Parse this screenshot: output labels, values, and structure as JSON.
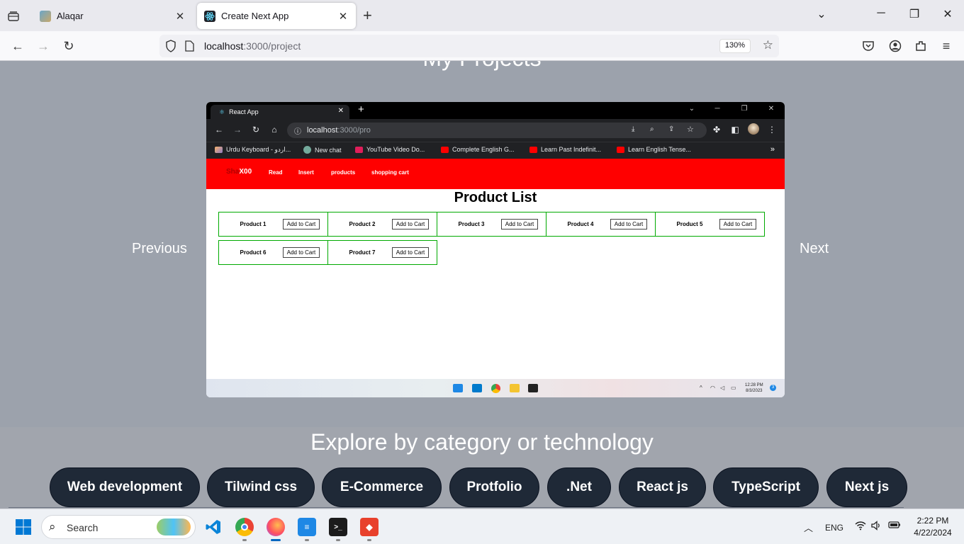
{
  "browser": {
    "tabs": [
      {
        "title": "Alaqar",
        "active": false
      },
      {
        "title": "Create Next App",
        "active": true
      }
    ],
    "url_host": "localhost",
    "url_path": ":3000/project",
    "zoom": "130%"
  },
  "page": {
    "heading": "My Projects",
    "prev_label": "Previous",
    "next_label": "Next",
    "explore_title": "Explore by category or technology",
    "categories": [
      "Web development",
      "Tilwind css",
      "E-Commerce",
      "Protfolio",
      ".Net",
      "React js",
      "TypeScript",
      "Next js"
    ]
  },
  "screenshot": {
    "tab_title": "React App",
    "url_host": "localhost",
    "url_path": ":3000/pro",
    "bookmarks": [
      "Urdu Keyboard - اردو...",
      "New chat",
      "YouTube Video Do...",
      "Complete English G...",
      "Learn Past Indefinit...",
      "Learn English Tense..."
    ],
    "bookmarks_more": "»",
    "brand_s": "Sha",
    "brand_rest": "X00",
    "nav": [
      "Read",
      "Insert",
      "products",
      "shopping cart"
    ],
    "title": "Product List",
    "products": [
      "Product 1",
      "Product 2",
      "Product 3",
      "Product 4",
      "Product 5",
      "Product 6",
      "Product 7"
    ],
    "add_label": "Add to Cart",
    "time": "12:28 PM",
    "date": "8/3/2023",
    "notif": "3"
  },
  "taskbar": {
    "search_placeholder": "Search",
    "lang": "ENG",
    "time": "2:22 PM",
    "date": "4/22/2024"
  }
}
